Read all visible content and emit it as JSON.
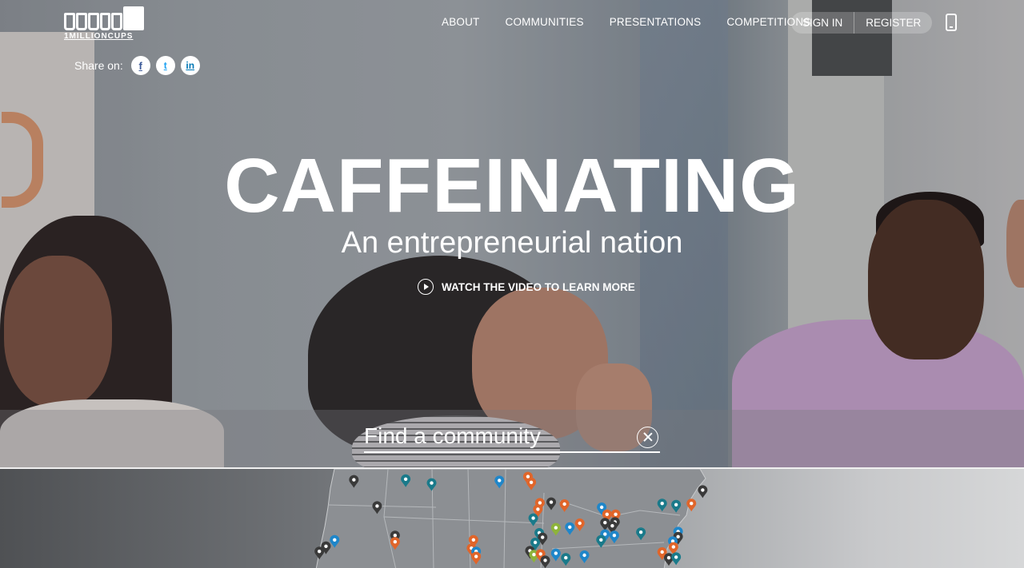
{
  "brand": {
    "logo_text": "1MILLIONCUPS"
  },
  "share": {
    "label": "Share on:",
    "facebook_glyph": "f",
    "twitter_glyph": "t",
    "linkedin_glyph": "in"
  },
  "nav": {
    "items": [
      {
        "label": "ABOUT"
      },
      {
        "label": "COMMUNITIES"
      },
      {
        "label": "PRESENTATIONS"
      },
      {
        "label": "COMPETITIONS"
      }
    ],
    "sign_in": "SIGN IN",
    "register": "REGISTER"
  },
  "hero": {
    "headline": "CAFFEINATING",
    "subhead": "An entrepreneurial nation",
    "watch_video": "WATCH THE VIDEO TO LEARN MORE"
  },
  "search": {
    "placeholder": "Find a community"
  },
  "map": {
    "pin_colors": {
      "blue": "#1f86c9",
      "orange": "#e0652a",
      "dark": "#3a3a3a",
      "teal": "#1a7a8a",
      "green": "#8db33a"
    },
    "pins": [
      {
        "lon": -119.3,
        "lat": 47.8,
        "color": "dark"
      },
      {
        "lon": -111.5,
        "lat": 47.9,
        "color": "teal"
      },
      {
        "lon": -107.6,
        "lat": 47.3,
        "color": "teal"
      },
      {
        "lon": -115.8,
        "lat": 43.7,
        "color": "dark"
      },
      {
        "lon": -122.2,
        "lat": 38.4,
        "color": "blue"
      },
      {
        "lon": -123.5,
        "lat": 37.4,
        "color": "dark"
      },
      {
        "lon": -124.5,
        "lat": 36.6,
        "color": "dark"
      },
      {
        "lon": -113.1,
        "lat": 39.1,
        "color": "dark"
      },
      {
        "lon": -113.1,
        "lat": 38.1,
        "color": "orange"
      },
      {
        "lon": -97.4,
        "lat": 47.7,
        "color": "blue"
      },
      {
        "lon": -93.1,
        "lat": 48.3,
        "color": "orange"
      },
      {
        "lon": -92.6,
        "lat": 47.4,
        "color": "orange"
      },
      {
        "lon": -91.3,
        "lat": 44.2,
        "color": "orange"
      },
      {
        "lon": -89.6,
        "lat": 44.3,
        "color": "dark"
      },
      {
        "lon": -87.6,
        "lat": 44.0,
        "color": "orange"
      },
      {
        "lon": -91.6,
        "lat": 43.2,
        "color": "orange"
      },
      {
        "lon": -92.3,
        "lat": 41.8,
        "color": "teal"
      },
      {
        "lon": -91.4,
        "lat": 39.5,
        "color": "teal"
      },
      {
        "lon": -90.9,
        "lat": 38.8,
        "color": "dark"
      },
      {
        "lon": -92.0,
        "lat": 38.0,
        "color": "teal"
      },
      {
        "lon": -88.9,
        "lat": 40.3,
        "color": "green"
      },
      {
        "lon": -86.8,
        "lat": 40.4,
        "color": "blue"
      },
      {
        "lon": -85.3,
        "lat": 41.0,
        "color": "orange"
      },
      {
        "lon": -82.0,
        "lat": 43.5,
        "color": "blue"
      },
      {
        "lon": -81.2,
        "lat": 42.4,
        "color": "orange"
      },
      {
        "lon": -79.9,
        "lat": 42.4,
        "color": "orange"
      },
      {
        "lon": -81.5,
        "lat": 41.1,
        "color": "dark"
      },
      {
        "lon": -80.0,
        "lat": 41.2,
        "color": "dark"
      },
      {
        "lon": -80.4,
        "lat": 40.6,
        "color": "dark"
      },
      {
        "lon": -81.5,
        "lat": 39.3,
        "color": "blue"
      },
      {
        "lon": -80.1,
        "lat": 39.1,
        "color": "blue"
      },
      {
        "lon": -82.1,
        "lat": 38.4,
        "color": "teal"
      },
      {
        "lon": -76.1,
        "lat": 39.6,
        "color": "teal"
      },
      {
        "lon": -72.9,
        "lat": 44.1,
        "color": "teal"
      },
      {
        "lon": -70.8,
        "lat": 43.9,
        "color": "teal"
      },
      {
        "lon": -68.5,
        "lat": 44.1,
        "color": "orange"
      },
      {
        "lon": -66.8,
        "lat": 46.2,
        "color": "dark"
      },
      {
        "lon": -70.5,
        "lat": 39.7,
        "color": "blue"
      },
      {
        "lon": -70.5,
        "lat": 38.9,
        "color": "dark"
      },
      {
        "lon": -71.3,
        "lat": 38.2,
        "color": "blue"
      },
      {
        "lon": -71.2,
        "lat": 37.3,
        "color": "orange"
      },
      {
        "lon": -72.9,
        "lat": 36.5,
        "color": "orange"
      },
      {
        "lon": -71.9,
        "lat": 35.6,
        "color": "dark"
      },
      {
        "lon": -70.8,
        "lat": 35.7,
        "color": "teal"
      },
      {
        "lon": -101.3,
        "lat": 38.4,
        "color": "orange"
      },
      {
        "lon": -101.6,
        "lat": 37.1,
        "color": "orange"
      },
      {
        "lon": -100.9,
        "lat": 36.6,
        "color": "blue"
      },
      {
        "lon": -100.9,
        "lat": 35.8,
        "color": "orange"
      },
      {
        "lon": -92.8,
        "lat": 36.7,
        "color": "dark"
      },
      {
        "lon": -92.2,
        "lat": 36.1,
        "color": "green"
      },
      {
        "lon": -91.2,
        "lat": 36.2,
        "color": "orange"
      },
      {
        "lon": -90.5,
        "lat": 35.2,
        "color": "dark"
      },
      {
        "lon": -88.9,
        "lat": 36.3,
        "color": "blue"
      },
      {
        "lon": -87.4,
        "lat": 35.6,
        "color": "teal"
      },
      {
        "lon": -84.6,
        "lat": 36.0,
        "color": "blue"
      }
    ]
  }
}
